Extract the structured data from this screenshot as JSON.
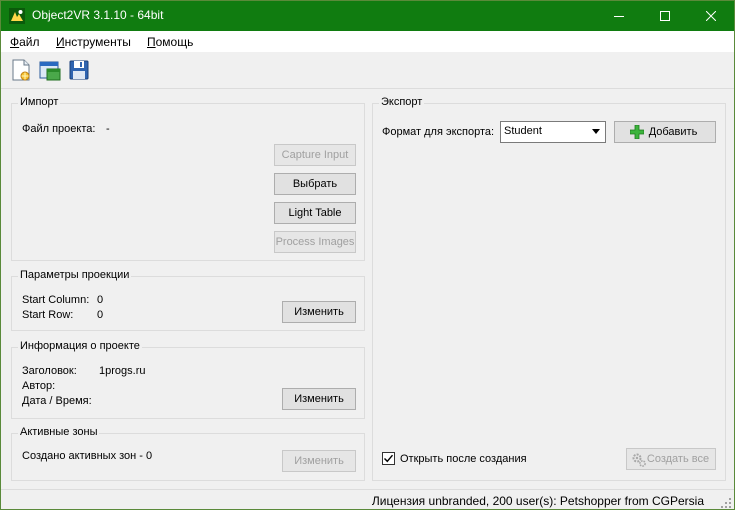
{
  "window": {
    "title": "Object2VR 3.1.10 - 64bit",
    "controls": {
      "minimize": "minimize-icon",
      "maximize": "maximize-icon",
      "close": "close-icon"
    }
  },
  "menu": {
    "file": {
      "accel": "Ф",
      "rest": "айл"
    },
    "tools": {
      "accel": "И",
      "rest": "нструменты"
    },
    "help": {
      "accel": "П",
      "rest": "омощь"
    }
  },
  "toolbar": {
    "icons": [
      "new-project-icon",
      "open-project-icon",
      "save-project-icon"
    ]
  },
  "import": {
    "title": "Импорт",
    "project_file_label": "Файл проекта:",
    "project_file_value": "-",
    "buttons": {
      "capture_input": "Capture Input",
      "choose": "Выбрать",
      "light_table": "Light Table",
      "process_images": "Process Images"
    }
  },
  "projection": {
    "title": "Параметры проекции",
    "start_column_label": "Start Column:",
    "start_column_value": "0",
    "start_row_label": "Start Row:",
    "start_row_value": "0",
    "change_button": "Изменить"
  },
  "project_info": {
    "title": "Информация о проекте",
    "heading_label": "Заголовок:",
    "heading_value": "1progs.ru",
    "author_label": "Автор:",
    "datetime_label": "Дата / Время:",
    "change_button": "Изменить"
  },
  "active_zones": {
    "title": "Активные зоны",
    "created_text": "Создано активных зон - 0",
    "change_button": "Изменить"
  },
  "export": {
    "title": "Экспорт",
    "format_label": "Формат для экспорта:",
    "format_value": "Student",
    "add_button": "Добавить",
    "open_after_label": "Открыть после создания",
    "open_after_checked": true,
    "create_all_button": "Создать все"
  },
  "status": {
    "license": "Лицензия unbranded, 200 user(s): Petshopper from CGPersia"
  },
  "colors": {
    "titlebar": "#107c10",
    "add_icon": "#3cb43c"
  }
}
